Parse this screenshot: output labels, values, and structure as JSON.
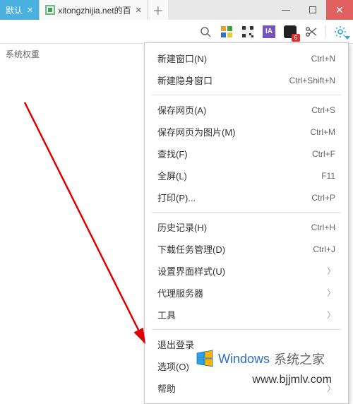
{
  "tabs": {
    "active_label": "默认",
    "second_label": "xitongzhijia.net的百"
  },
  "toolbar": {
    "ia_label": "IA",
    "badge_count": "6"
  },
  "left_text": "系统权重",
  "menu": {
    "g1": [
      {
        "label": "新建窗口(N)",
        "shortcut": "Ctrl+N"
      },
      {
        "label": "新建隐身窗口",
        "shortcut": "Ctrl+Shift+N"
      }
    ],
    "g2": [
      {
        "label": "保存网页(A)",
        "shortcut": "Ctrl+S"
      },
      {
        "label": "保存网页为图片(M)",
        "shortcut": "Ctrl+M"
      },
      {
        "label": "查找(F)",
        "shortcut": "Ctrl+F"
      },
      {
        "label": "全屏(L)",
        "shortcut": "F11"
      },
      {
        "label": "打印(P)...",
        "shortcut": "Ctrl+P"
      }
    ],
    "g3": [
      {
        "label": "历史记录(H)",
        "shortcut": "Ctrl+H"
      },
      {
        "label": "下载任务管理(D)",
        "shortcut": "Ctrl+J"
      },
      {
        "label": "设置界面样式(U)",
        "chev": true
      },
      {
        "label": "代理服务器",
        "chev": true
      },
      {
        "label": "工具",
        "chev": true
      }
    ],
    "g4": [
      {
        "label": "退出登录"
      },
      {
        "label": "选项(O)"
      },
      {
        "label": "帮助",
        "chev": true
      }
    ]
  },
  "watermark": {
    "brand_a": "Windows",
    "brand_b": "系统之家",
    "url": "www.bjjmlv.com"
  }
}
